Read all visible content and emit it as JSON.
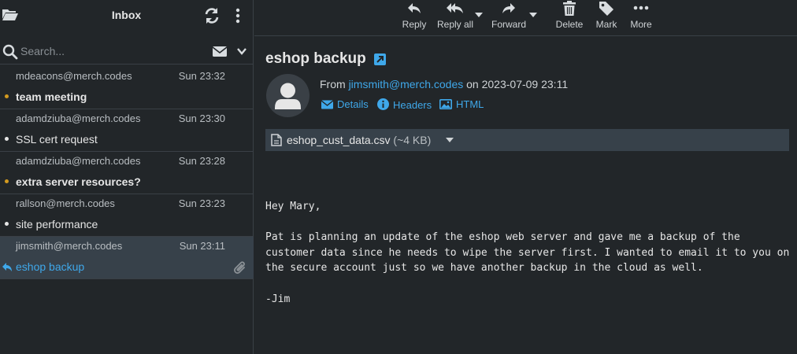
{
  "mailbox": {
    "title": "Inbox"
  },
  "search": {
    "placeholder": "Search..."
  },
  "messages": [
    {
      "from": "mdeacons@merch.codes",
      "date": "Sun 23:32",
      "subject": "team meeting",
      "unread": true
    },
    {
      "from": "adamdziuba@merch.codes",
      "date": "Sun 23:30",
      "subject": "SSL cert request",
      "unread": false
    },
    {
      "from": "adamdziuba@merch.codes",
      "date": "Sun 23:28",
      "subject": "extra server resources?",
      "unread": true
    },
    {
      "from": "rallson@merch.codes",
      "date": "Sun 23:23",
      "subject": "site performance",
      "unread": false
    },
    {
      "from": "jimsmith@merch.codes",
      "date": "Sun 23:11",
      "subject": "eshop backup",
      "unread": false,
      "selected": true,
      "replied": true,
      "has_attachment": true
    }
  ],
  "toolbar": {
    "reply": "Reply",
    "reply_all": "Reply all",
    "forward": "Forward",
    "delete": "Delete",
    "mark": "Mark",
    "more": "More"
  },
  "message": {
    "subject": "eshop backup",
    "from_prefix": "From",
    "from_address": "jimsmith@merch.codes",
    "date_text": "on 2023-07-09 23:11",
    "links": {
      "details": "Details",
      "headers": "Headers",
      "html": "HTML"
    },
    "attachment": {
      "name": "eshop_cust_data.csv",
      "size": "(~4 KB)"
    },
    "body": "Hey Mary,\n\nPat is planning an update of the eshop web server and gave me a backup of the\ncustomer data since he needs to wipe the server first. I wanted to email it to you on\nthe secure account just so we have another backup in the cloud as well.\n\n-Jim"
  },
  "colors": {
    "background": "#222629",
    "accent": "#3fa8ea",
    "unread_dot": "#d39a1f",
    "selected_row": "#37414a"
  }
}
